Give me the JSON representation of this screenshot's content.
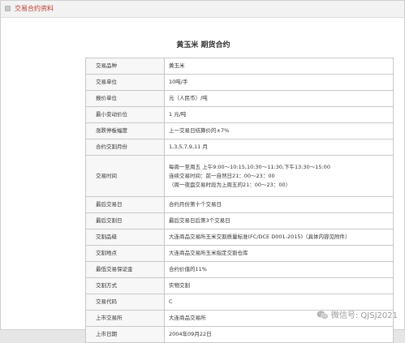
{
  "header": {
    "title": "交易合约资料"
  },
  "contract": {
    "title": "黄玉米 期货合约",
    "rows": [
      {
        "label": "交易品种",
        "value": "黄玉米"
      },
      {
        "label": "交易单位",
        "value": "10吨/手"
      },
      {
        "label": "报价单位",
        "value": "元（人民币）/吨"
      },
      {
        "label": "最小变动价位",
        "value": "1 元/吨"
      },
      {
        "label": "涨跌停板幅度",
        "value": "上一交易日结算价的±7%"
      },
      {
        "label": "合约交割月份",
        "value": "1,3,5,7,9,11 月"
      },
      {
        "label": "交易时间",
        "lines": [
          "每周一至周五 上午9:00～10:15,10:30～11:30,下午13:30～15:00",
          "连续交易时间：前一自然日21：00～23：00",
          "（周一夜盘交易时段为上周五的21：00～23：00）"
        ]
      },
      {
        "label": "最后交易日",
        "value": "合约月份第十个交易日"
      },
      {
        "label": "最后交割日",
        "value": "最后交易日后第3个交易日"
      },
      {
        "label": "交割品级",
        "value": "大连商品交易所玉米交割质量标准(FC/DCE D001-2015)（具体内容见附件）"
      },
      {
        "label": "交割地点",
        "value": "大连商品交易所玉米指定交割仓库"
      },
      {
        "label": "最低交易保证金",
        "value": "合约价值的11%"
      },
      {
        "label": "交割方式",
        "value": "实物交割"
      },
      {
        "label": "交易代码",
        "value": "C"
      },
      {
        "label": "上市交易所",
        "value": "大连商品交易所"
      },
      {
        "label": "上市日期",
        "value": "2004年09月22日"
      }
    ]
  },
  "watermark": {
    "icon": "wechat-icon",
    "text": "微信号: QJSJ2021"
  }
}
